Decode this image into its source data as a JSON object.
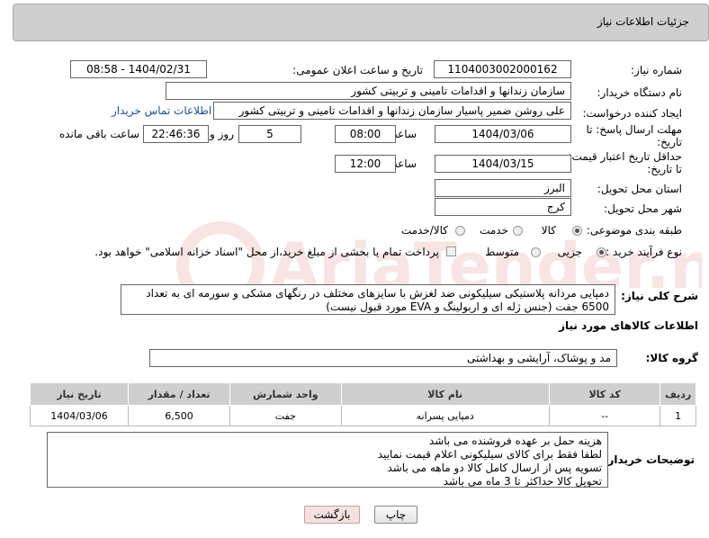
{
  "panel": {
    "title": "جزئیات اطلاعات نیاز"
  },
  "form": {
    "need_number_label": "شماره نیاز:",
    "need_number": "1104003002000162",
    "announce_label": "تاریخ و ساعت اعلان عمومی:",
    "announce_value": "1404/02/31 - 08:58",
    "buyer_org_label": "نام دستگاه خریدار:",
    "buyer_org": "سازمان زندانها و اقدامات تامینی و تربیتی کشور",
    "creator_label": "ایجاد کننده درخواست:",
    "creator": "علی روشن ضمیر پاسیار سازمان زندانها و اقدامات تامینی و تربیتی کشور",
    "contact_link": "اطلاعات تماس خریدار",
    "deadline_label_1": "مهلت ارسال پاسخ: تا",
    "deadline_label_2": "تاریخ:",
    "deadline_date": "1404/03/06",
    "time_word": "ساعت",
    "deadline_time": "08:00",
    "days_count": "5",
    "days_word": "روز و",
    "remaining_time": "22:46:36",
    "remaining_word": "ساعت باقی مانده",
    "validity_label_1": "حداقل تاریخ اعتبار قیمت:",
    "validity_label_2": "تا تاریخ:",
    "validity_date": "1404/03/15",
    "validity_time": "12:00",
    "province_label": "استان محل تحویل:",
    "province": "البرز",
    "city_label": "شهر محل تحویل:",
    "city": "کرج",
    "category_label": "طبقه بندی موضوعی:",
    "category_options": [
      "کالا",
      "خدمت",
      "کالا/خدمت"
    ],
    "category_selected": "کالا",
    "process_label": "نوع فرآیند خرید :",
    "process_options": [
      "جزیی",
      "متوسط"
    ],
    "process_selected": "جزیی",
    "payment_note": "پرداخت تمام یا بخشی از مبلغ خرید،از محل \"اسناد خزانه اسلامی\" خواهد بود."
  },
  "description": {
    "label": "شرح کلی نیاز:",
    "line1": "دمپایی مردانه پلاستیکی سیلیکونی ضد لغزش با سایزهای مختلف در رنگهای مشکی و سورمه ای به تعداد",
    "line2": "6500 جفت (جنس ژله ای و اربولینگ و EVA مورد قبول نیست)"
  },
  "goods": {
    "section_title": "اطلاعات کالاهای مورد نیاز",
    "group_label": "گروه کالا:",
    "group_value": "مد و پوشاک، آرایشی و بهداشتی",
    "headers": [
      "ردیف",
      "کد کالا",
      "نام کالا",
      "واحد شمارش",
      "تعداد / مقدار",
      "تاریخ نیاز"
    ],
    "rows": [
      [
        "1",
        "--",
        "دمپایی پسرانه",
        "جفت",
        "6,500",
        "1404/03/06"
      ]
    ]
  },
  "buyer_notes": {
    "label": "توضیحات خریدار:",
    "lines": [
      "هزینه حمل بر عهده فروشنده می باشد",
      "لطفا فقط برای کالای سیلیکونی اعلام قیمت نمایید",
      "تسویه پس از ارسال کامل کالا دو ماهه می باشد",
      "تحویل کالا حداکثر تا 3 ماه می باشد"
    ]
  },
  "buttons": {
    "print": "چاپ",
    "back": "بازگشت"
  },
  "watermark_text": "AriaTender.net"
}
